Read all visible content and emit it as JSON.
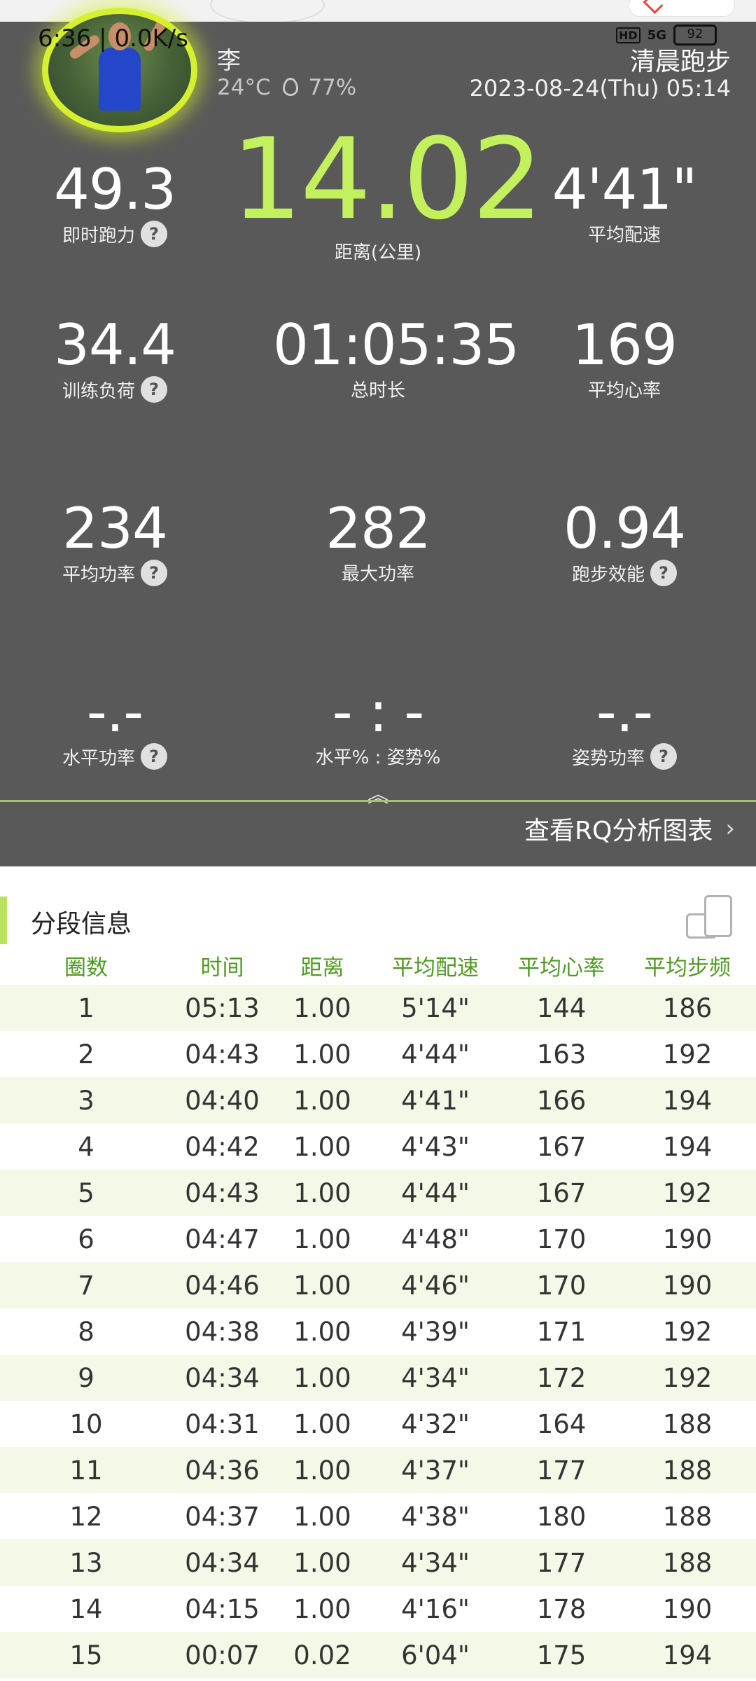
{
  "status_bar": {
    "time": "6:36",
    "net_speed": "0.0K/s",
    "hd": "HD",
    "signal": "5G",
    "battery": "92"
  },
  "header": {
    "user_name": "李",
    "temperature": "24°C",
    "humidity": "77%",
    "run_type": "清晨跑步",
    "datetime": "2023-08-24(Thu) 05:14"
  },
  "metrics": {
    "power_now": {
      "value": "49.3",
      "label": "即时跑力"
    },
    "distance": {
      "value": "14.02",
      "label": "距离(公里)"
    },
    "avg_pace": {
      "value": "4'41\"",
      "label": "平均配速"
    },
    "training_load": {
      "value": "34.4",
      "label": "训练负荷"
    },
    "total_time": {
      "value": "01:05:35",
      "label": "总时长"
    },
    "avg_hr": {
      "value": "169",
      "label": "平均心率"
    },
    "avg_power": {
      "value": "234",
      "label": "平均功率"
    },
    "max_power": {
      "value": "282",
      "label": "最大功率"
    },
    "efficiency": {
      "value": "0.94",
      "label": "跑步效能"
    },
    "horiz_power": {
      "value": "-.-",
      "label": "水平功率"
    },
    "horiz_ratio": {
      "value": "- : -",
      "label": "水平% : 姿势%"
    },
    "form_power": {
      "value": "-.-",
      "label": "姿势功率"
    }
  },
  "rq_link": {
    "label": "查看RQ分析图表"
  },
  "splits": {
    "title": "分段信息",
    "columns": [
      "圈数",
      "时间",
      "距离",
      "平均配速",
      "平均心率",
      "平均步频"
    ],
    "rows": [
      [
        "1",
        "05:13",
        "1.00",
        "5'14\"",
        "144",
        "186"
      ],
      [
        "2",
        "04:43",
        "1.00",
        "4'44\"",
        "163",
        "192"
      ],
      [
        "3",
        "04:40",
        "1.00",
        "4'41\"",
        "166",
        "194"
      ],
      [
        "4",
        "04:42",
        "1.00",
        "4'43\"",
        "167",
        "194"
      ],
      [
        "5",
        "04:43",
        "1.00",
        "4'44\"",
        "167",
        "192"
      ],
      [
        "6",
        "04:47",
        "1.00",
        "4'48\"",
        "170",
        "190"
      ],
      [
        "7",
        "04:46",
        "1.00",
        "4'46\"",
        "170",
        "190"
      ],
      [
        "8",
        "04:38",
        "1.00",
        "4'39\"",
        "171",
        "192"
      ],
      [
        "9",
        "04:34",
        "1.00",
        "4'34\"",
        "172",
        "192"
      ],
      [
        "10",
        "04:31",
        "1.00",
        "4'32\"",
        "164",
        "188"
      ],
      [
        "11",
        "04:36",
        "1.00",
        "4'37\"",
        "177",
        "188"
      ],
      [
        "12",
        "04:37",
        "1.00",
        "4'38\"",
        "180",
        "188"
      ],
      [
        "13",
        "04:34",
        "1.00",
        "4'34\"",
        "177",
        "188"
      ],
      [
        "14",
        "04:15",
        "1.00",
        "4'16\"",
        "178",
        "190"
      ],
      [
        "15",
        "00:07",
        "0.02",
        "6'04\"",
        "175",
        "194"
      ]
    ]
  },
  "colors": {
    "accent_green": "#c3f05d",
    "header_green": "#4f9a22",
    "panel_gray": "#595959"
  }
}
